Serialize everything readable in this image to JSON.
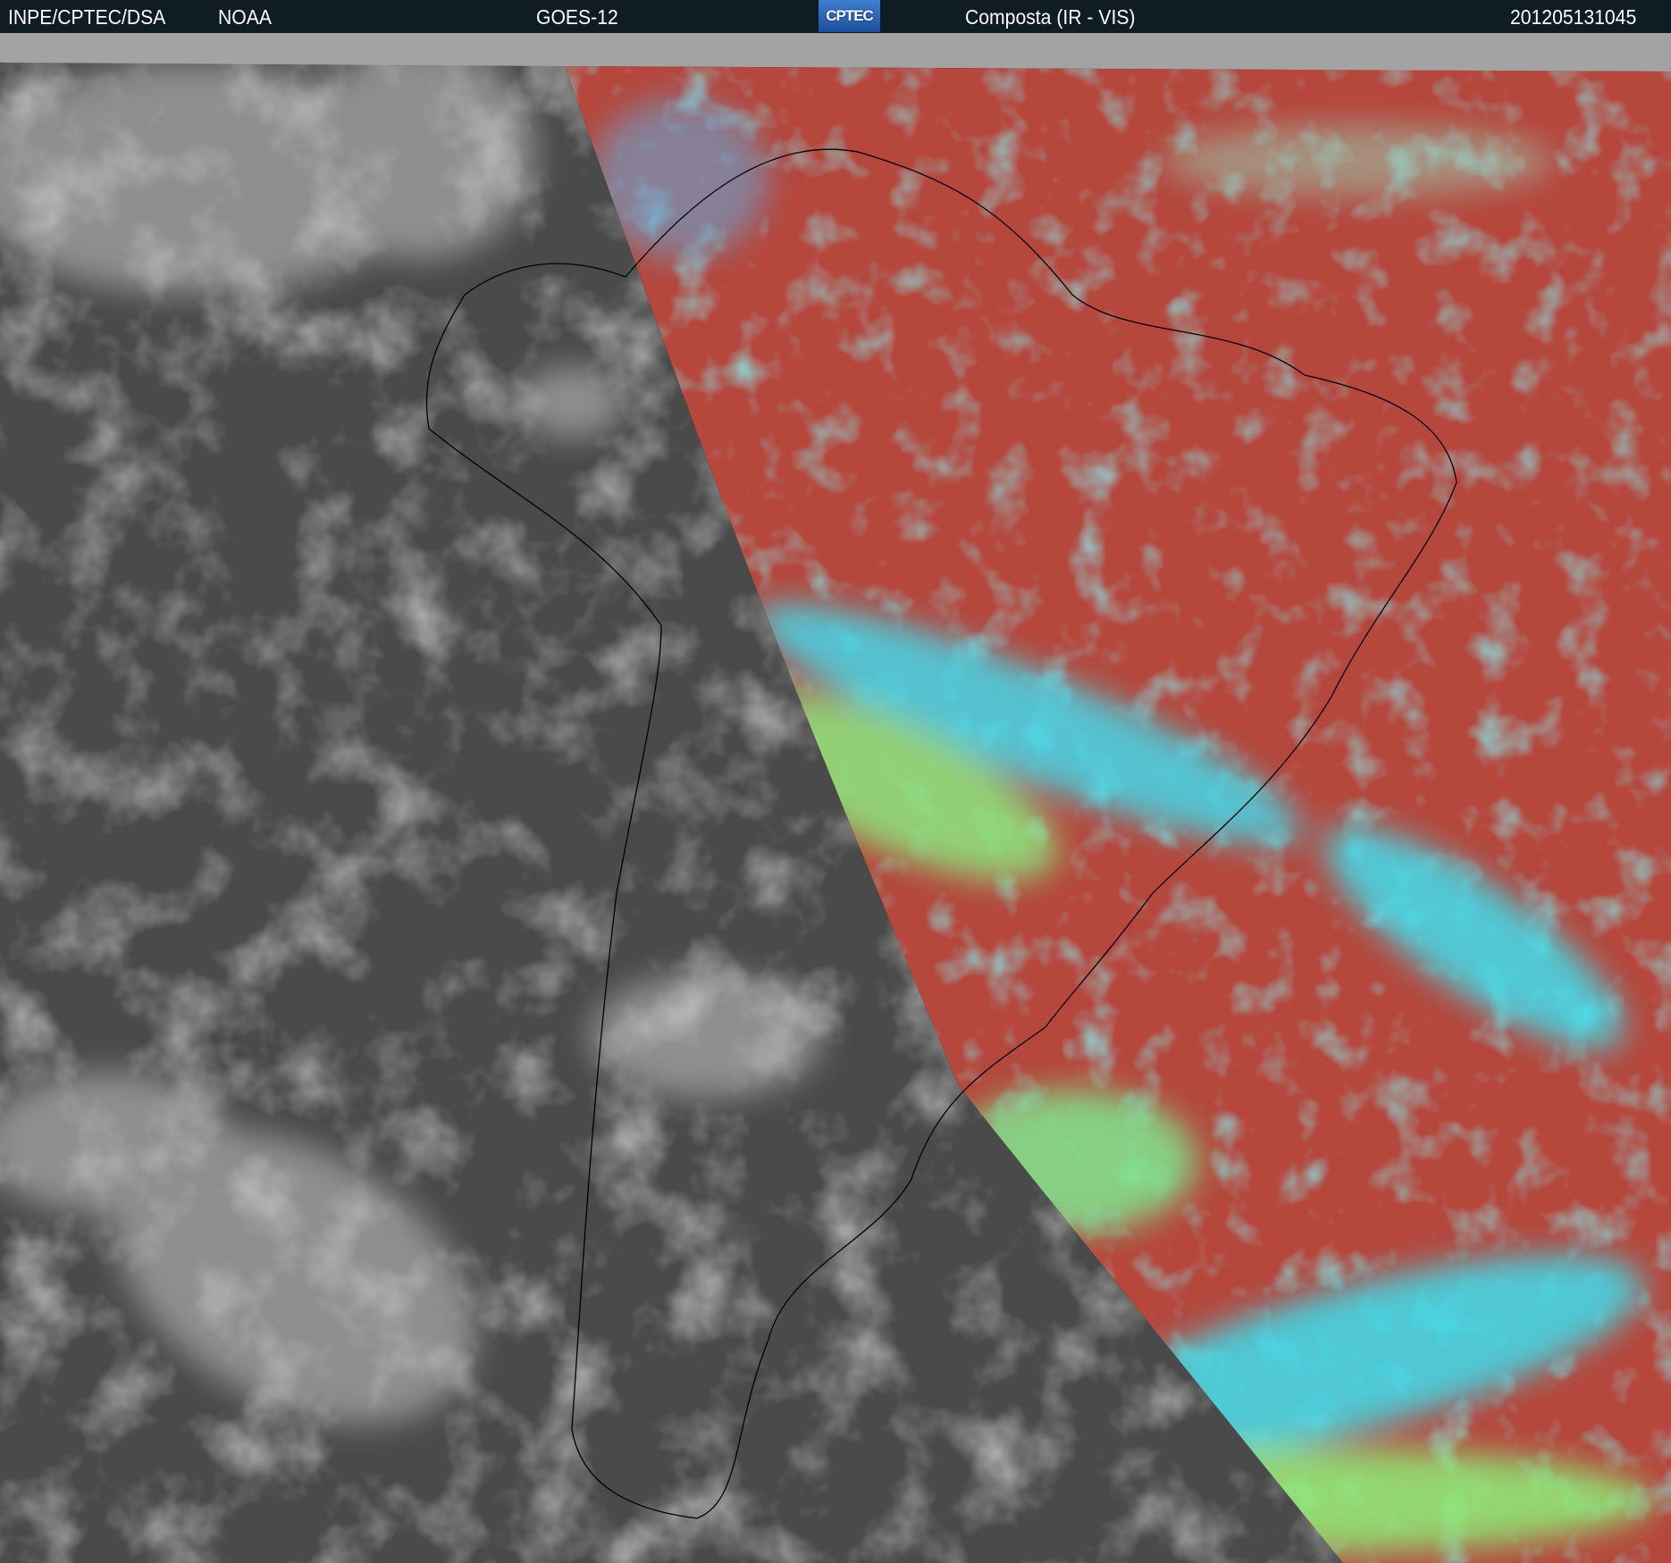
{
  "header": {
    "source": "INPE/CPTEC/DSA",
    "agency": "NOAA",
    "satellite": "GOES-12",
    "logo_text": "CPTEC",
    "product": "Composta (IR - VIS)",
    "timestamp": "201205131045"
  },
  "colors": {
    "header_bg": "#0f1c24",
    "ir_gray": "#4a4a4a",
    "vis_red": "#b5473d",
    "cloud_cyan": "#3ee0f0",
    "cloud_green": "#8ef07a"
  }
}
